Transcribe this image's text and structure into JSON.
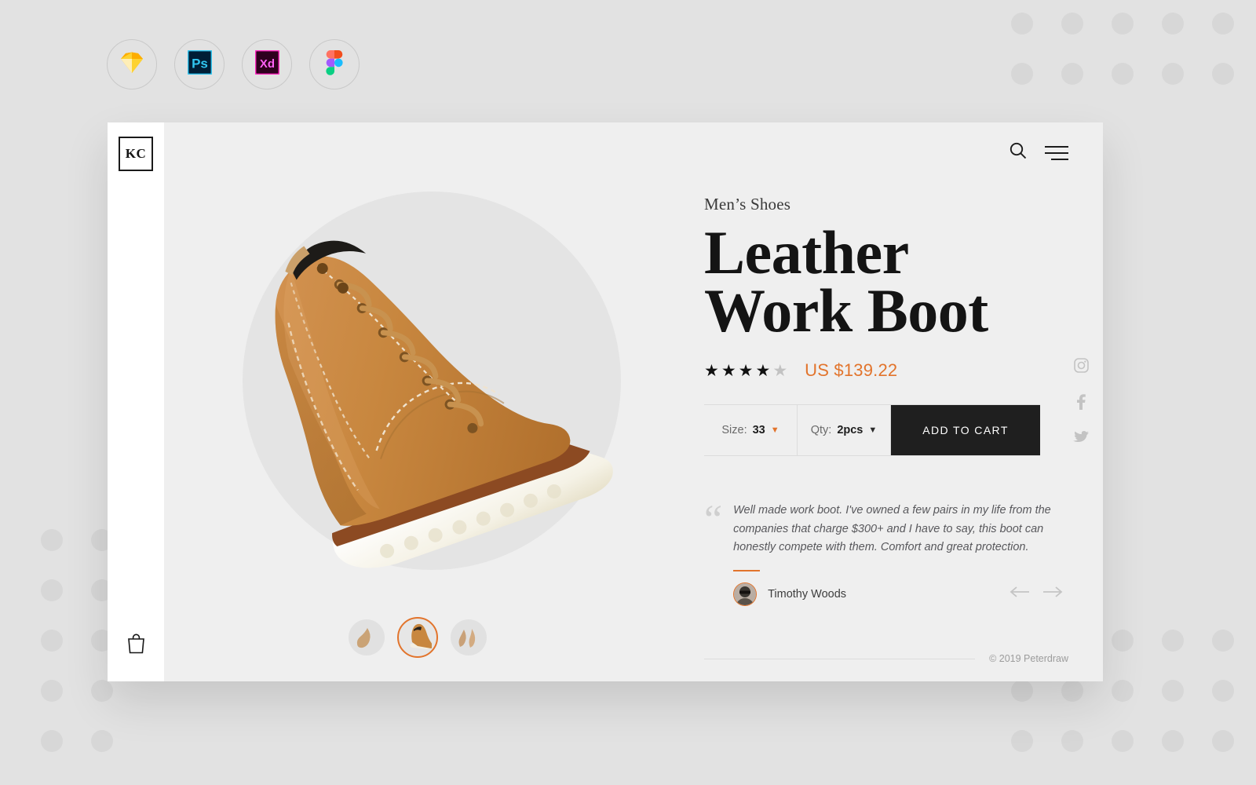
{
  "tool_badges": [
    {
      "name": "sketch-icon",
      "label": "Sketch"
    },
    {
      "name": "photoshop-icon",
      "label": "Ps"
    },
    {
      "name": "adobe-xd-icon",
      "label": "Xd"
    },
    {
      "name": "figma-icon",
      "label": "Figma"
    }
  ],
  "sidebar": {
    "logo_text": "KC",
    "cart_icon": "shopping-bag-icon"
  },
  "header": {
    "search_icon": "search-icon",
    "menu_icon": "hamburger-menu-icon"
  },
  "product": {
    "category": "Men’s Shoes",
    "title_line_1": "Leather",
    "title_line_2": "Work Boot",
    "rating": 4,
    "rating_max": 5,
    "price": "US $139.22",
    "size_label": "Size:",
    "size_value": "33",
    "qty_label": "Qty:",
    "qty_value": "2pcs",
    "add_to_cart_label": "ADD TO CART",
    "thumbnails": [
      {
        "name": "thumbnail-1",
        "selected": false
      },
      {
        "name": "thumbnail-2",
        "selected": true
      },
      {
        "name": "thumbnail-3",
        "selected": false
      }
    ]
  },
  "testimonial": {
    "quote_glyph": "“",
    "text": "Well made work boot. I've owned a few pairs in my life from the companies that charge $300+ and I have to say, this boot can honestly compete with them. Comfort and great protection.",
    "author": "Timothy Woods",
    "prev_icon": "arrow-left-icon",
    "next_icon": "arrow-right-icon"
  },
  "social": [
    {
      "name": "instagram-icon",
      "label": "Instagram"
    },
    {
      "name": "facebook-icon",
      "label": "Facebook"
    },
    {
      "name": "twitter-icon",
      "label": "Twitter"
    }
  ],
  "footer": {
    "copyright": "© 2019 Peterdraw"
  },
  "colors": {
    "accent": "#e2742c",
    "dark": "#1f1f1f",
    "page_bg": "#e2e2e2",
    "card_bg": "#efefef",
    "sidebar_bg": "#ffffff",
    "muted": "#9c9c9c"
  }
}
